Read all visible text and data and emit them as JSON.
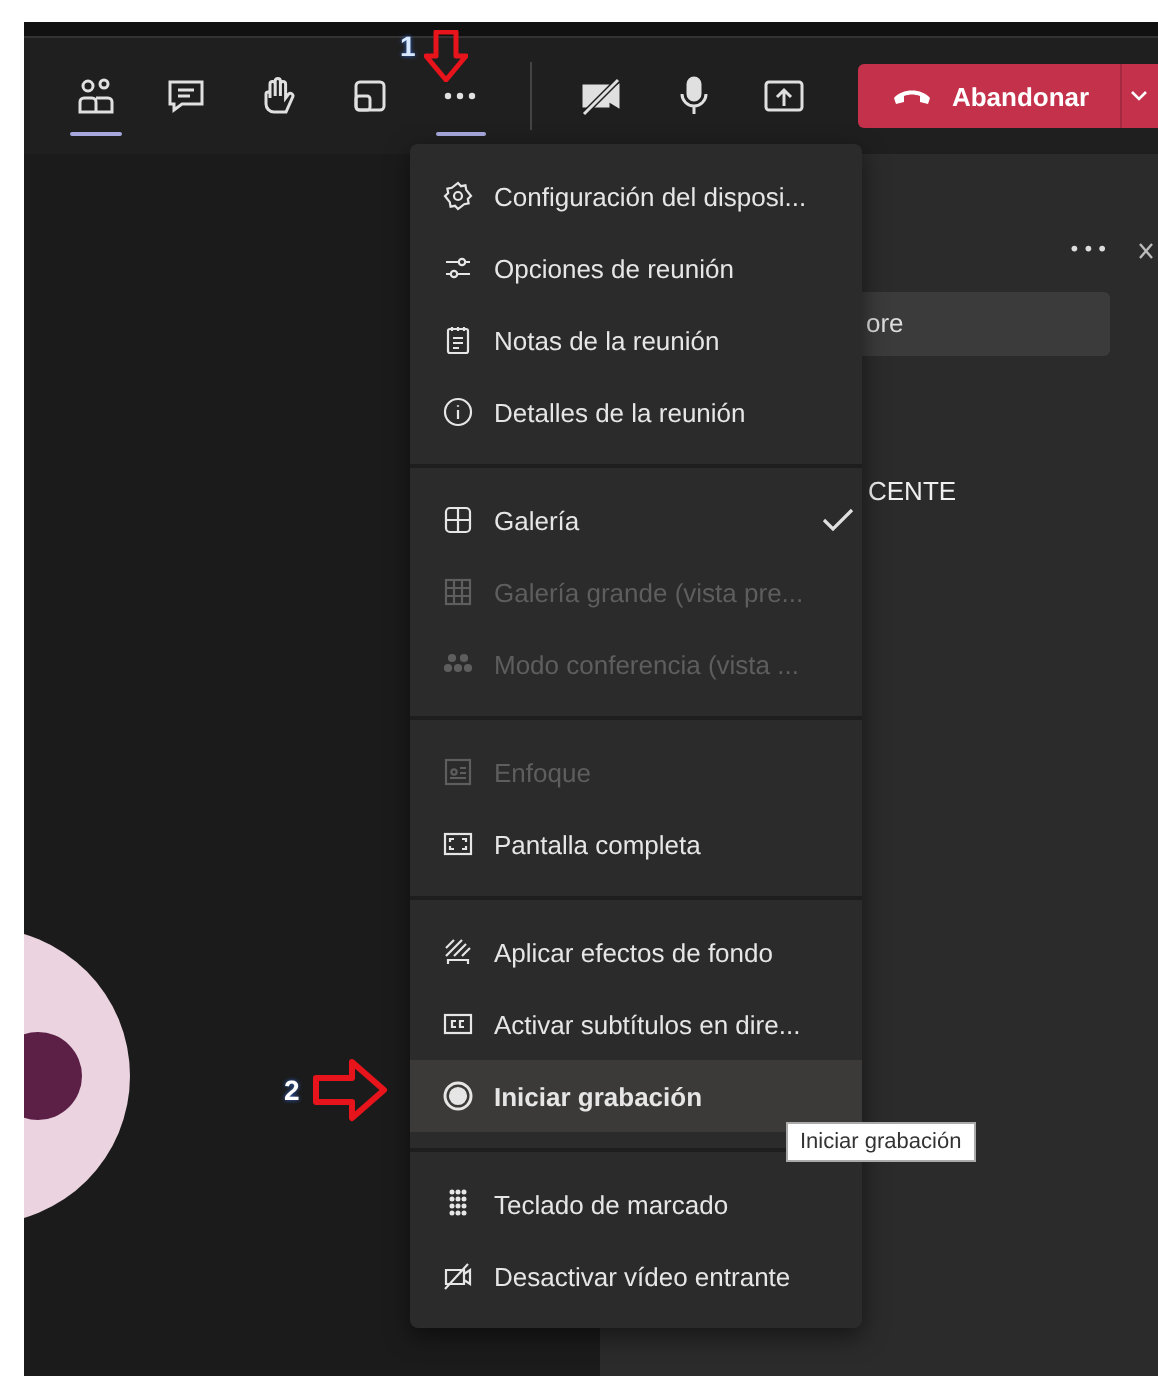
{
  "toolbar": {
    "items": [
      {
        "kind": "people",
        "selected": true
      },
      {
        "kind": "chat",
        "selected": false
      },
      {
        "kind": "hand",
        "selected": false
      },
      {
        "kind": "rooms",
        "selected": false
      },
      {
        "kind": "more",
        "selected": true
      },
      {
        "kind": "camera-off",
        "selected": false
      },
      {
        "kind": "mic",
        "selected": false
      },
      {
        "kind": "share",
        "selected": false
      }
    ],
    "leave_button": "Abandonar"
  },
  "side_panel": {
    "more_glyph": "•••",
    "search_value": "ore",
    "participant": "CENTE"
  },
  "menu": {
    "sections": [
      {
        "items": [
          {
            "kind": "gear",
            "label": "Configuración del disposi...",
            "disabled": false,
            "checked": false,
            "selected": false
          },
          {
            "kind": "sliders",
            "label": "Opciones de reunión",
            "disabled": false,
            "checked": false,
            "selected": false
          },
          {
            "kind": "notes",
            "label": "Notas de la reunión",
            "disabled": false,
            "checked": false,
            "selected": false
          },
          {
            "kind": "info",
            "label": "Detalles de la reunión",
            "disabled": false,
            "checked": false,
            "selected": false
          }
        ]
      },
      {
        "items": [
          {
            "kind": "grid4",
            "label": "Galería",
            "disabled": false,
            "checked": true,
            "selected": false
          },
          {
            "kind": "grid9",
            "label": "Galería grande (vista pre...",
            "disabled": true,
            "checked": false,
            "selected": false
          },
          {
            "kind": "group",
            "label": "Modo conferencia (vista ...",
            "disabled": true,
            "checked": false,
            "selected": false
          }
        ]
      },
      {
        "items": [
          {
            "kind": "focus",
            "label": "Enfoque",
            "disabled": true,
            "checked": false,
            "selected": false
          },
          {
            "kind": "fullscreen",
            "label": "Pantalla completa",
            "disabled": false,
            "checked": false,
            "selected": false
          }
        ]
      },
      {
        "items": [
          {
            "kind": "background",
            "label": "Aplicar efectos de fondo",
            "disabled": false,
            "checked": false,
            "selected": false
          },
          {
            "kind": "cc",
            "label": "Activar subtítulos en dire...",
            "disabled": false,
            "checked": false,
            "selected": false
          },
          {
            "kind": "record",
            "label": "Iniciar grabación",
            "disabled": false,
            "checked": false,
            "selected": true
          }
        ]
      },
      {
        "items": [
          {
            "kind": "dialpad",
            "label": "Teclado de marcado",
            "disabled": false,
            "checked": false,
            "selected": false
          },
          {
            "kind": "video-off",
            "label": "Desactivar vídeo entrante",
            "disabled": false,
            "checked": false,
            "selected": false
          }
        ]
      }
    ]
  },
  "tooltip": "Iniciar grabación",
  "annotations": [
    {
      "number": "1",
      "kind": "down"
    },
    {
      "number": "2",
      "kind": "right"
    }
  ]
}
